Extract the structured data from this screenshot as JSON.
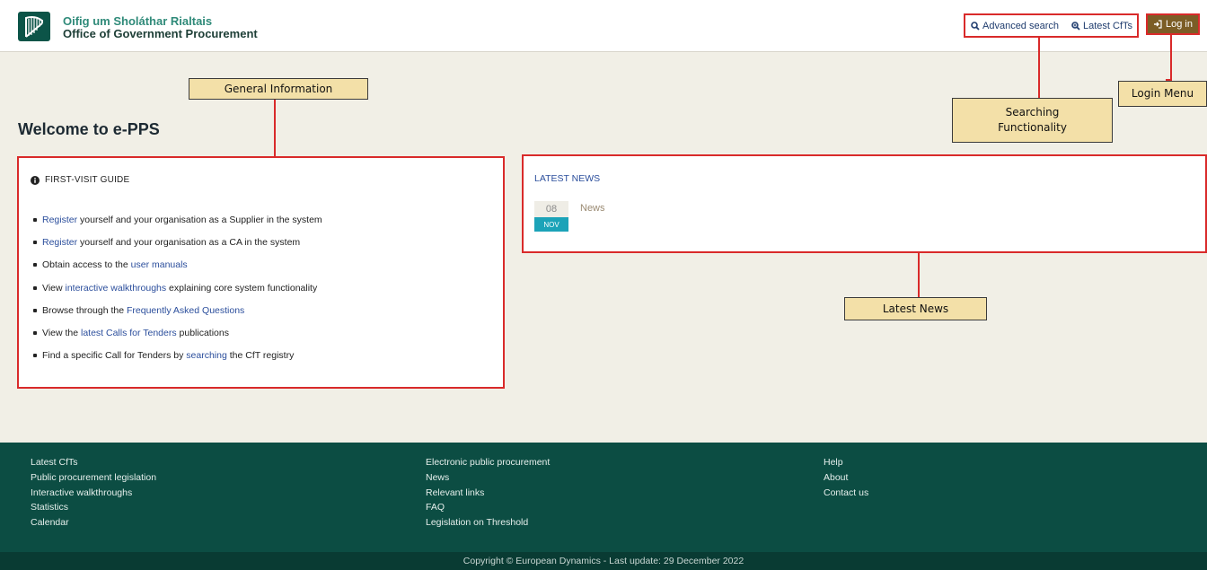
{
  "header": {
    "brand_irish": "Oifig um Sholáthar Rialtais",
    "brand_english": "Office of Government Procurement",
    "advanced_search": "Advanced search",
    "latest_cfts": "Latest CfTs",
    "login": "Log in"
  },
  "callouts": {
    "general_information": "General Information",
    "login_menu": "Login Menu",
    "searching_line1": "Searching",
    "searching_line2": "Functionality",
    "latest_news": "Latest News"
  },
  "welcome": "Welcome to e-PPS",
  "guide": {
    "title": "FIRST-VISIT GUIDE",
    "items": [
      {
        "link": "Register",
        "rest": " yourself and your organisation as a Supplier in the system"
      },
      {
        "link": "Register",
        "rest": " yourself and your organisation as a CA in the system"
      },
      {
        "pre": "Obtain access to the ",
        "link": "user manuals"
      },
      {
        "pre": "View ",
        "link": "interactive walkthroughs",
        "rest": " explaining core system functionality"
      },
      {
        "pre": "Browse through the ",
        "link": "Frequently Asked Questions"
      },
      {
        "pre": "View the ",
        "link": "latest Calls for Tenders",
        "rest": " publications"
      },
      {
        "pre": "Find a specific Call for Tenders by ",
        "link": "searching",
        "rest": " the CfT registry"
      }
    ]
  },
  "news": {
    "title": "LATEST NEWS",
    "day": "08",
    "month": "NOV",
    "item": "News"
  },
  "footer": {
    "col1": [
      "Latest CfTs",
      "Public procurement legislation",
      "Interactive walkthroughs",
      "Statistics",
      "Calendar"
    ],
    "col2": [
      "Electronic public procurement",
      "News",
      "Relevant links",
      "FAQ",
      "Legislation on Threshold"
    ],
    "col3": [
      "Help",
      "About",
      "Contact us"
    ],
    "copyright": "Copyright © European Dynamics - Last update: 29 December 2022"
  },
  "colors": {
    "accent_red": "#d92a2a",
    "footer_green": "#0c4d43",
    "login_brown": "#7c5d26",
    "link_blue": "#2b4e9c",
    "callout_yellow": "#f3e0a8"
  }
}
